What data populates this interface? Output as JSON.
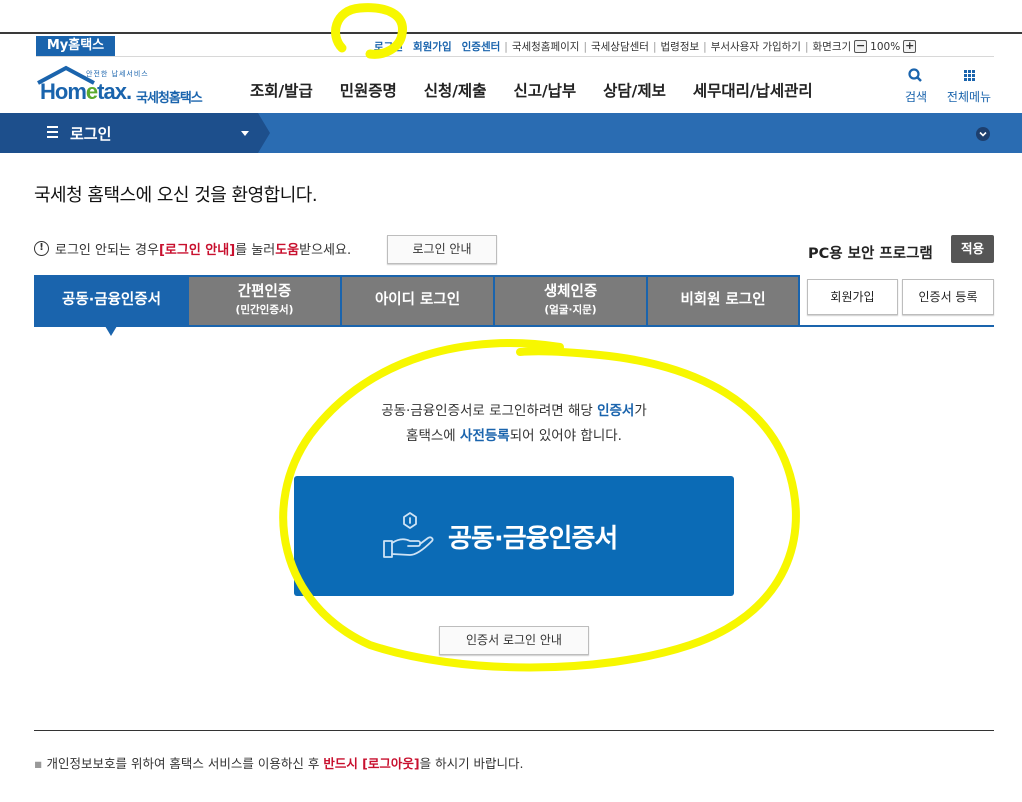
{
  "util": {
    "my_tab": "My홈택스",
    "login": "로그인",
    "join": "회원가입",
    "cert_center": "인증센터",
    "links": [
      "국세청홈페이지",
      "국세상담센터",
      "법령정보",
      "부서사용자 가입하기"
    ],
    "screen_size": "화면크기",
    "zoom_minus": "−",
    "zoom_value": "100%",
    "zoom_plus": "+"
  },
  "logo": {
    "small": "안전한 납세서비스",
    "word_a": "Hom",
    "word_e": "e",
    "word_b": "tax.",
    "kr": "국세청홈택스"
  },
  "gnb": [
    "조회/발급",
    "민원증명",
    "신청/제출",
    "신고/납부",
    "상담/제보",
    "세무대리/납세관리"
  ],
  "header_buttons": {
    "search": "검색",
    "all_menu": "전체메뉴"
  },
  "bluebar": {
    "title": "로그인"
  },
  "welcome": "국세청 홈택스에 오신 것을 환영합니다.",
  "notice": {
    "pre": "로그인 안되는 경우 ",
    "link": "[로그인 안내]",
    "mid": "를 눌러 ",
    "help": "도움",
    "post": "받으세요.",
    "button": "로그인 안내"
  },
  "pc_security": {
    "label": "PC용 보안 프로그램",
    "apply": "적용"
  },
  "tabs": [
    {
      "label": "공동·금융인증서",
      "sub": ""
    },
    {
      "label": "간편인증",
      "sub": "(민간인증서)"
    },
    {
      "label": "아이디 로그인",
      "sub": ""
    },
    {
      "label": "생체인증",
      "sub": "(얼굴·지문)"
    },
    {
      "label": "비회원 로그인",
      "sub": ""
    }
  ],
  "side_buttons": {
    "join": "회원가입",
    "cert_register": "인증서 등록"
  },
  "info": {
    "line1_pre": "공동·금융인증서로 로그인하려면 해당 ",
    "line1_link": "인증서",
    "line1_post": "가",
    "line2_pre": "홈택스에 ",
    "line2_link": "사전등록",
    "line2_post": "되어 있어야 합니다."
  },
  "cert_button": "공동·금융인증서",
  "cert_guide_button": "인증서 로그인 안내",
  "footer": {
    "pre": "개인정보보호를 위하여 홈택스 서비스를 이용하신 후 ",
    "bold": "반드시 [로그아웃]",
    "post": "을 하시기 바랍니다."
  },
  "colors": {
    "brand_blue": "#1a64ad",
    "button_blue": "#0b6bb6",
    "tab_gray": "#7b7b7b",
    "highlight": "#f7f700",
    "warn_red": "#c8102e"
  }
}
